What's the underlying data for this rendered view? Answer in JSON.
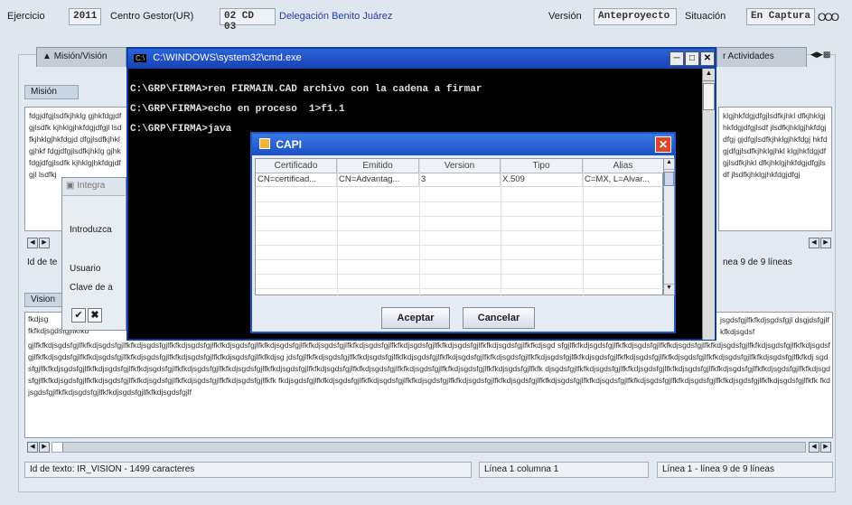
{
  "header": {
    "ejercicio_label": "Ejercicio",
    "ejercicio_value": "2011",
    "centro_label": "Centro Gestor(UR)",
    "centro_value": "02 CD 03",
    "centro_name": "Delegación Benito Juárez",
    "version_label": "Versión",
    "version_value": "Anteproyecto",
    "situacion_label": "Situación",
    "situacion_value": "En Captura",
    "circles": "OOO"
  },
  "tabs": {
    "left": "Misión/Visión",
    "right": "r Actividades"
  },
  "mision": {
    "title": "Misión",
    "text_left": "fdgjdfgjlsdfkjhklg gjhkfdgjdfgjlsdfk kjhklgjhkfdgjdfgjl lsdfkjhklgjhkfdgjd dfgjlsdfkjhklgjhkf fdgjdfgjlsdfkjhklg gjhkfdgjdfgjlsdfk kjhklgjhkfdgjdfgjl lsdfkj",
    "text_right": "klgjhkfdgjdfgjlsdfkjhkl dfkjhklgjhkfdgjdfgjlsdf jlsdfkjhklgjhkfdgjdfgj gjdfgjlsdfkjhklgjhkfdgj hkfdgjdfgjlsdfkjhklgjhkl klgjhkfdgjdfgjlsdfkjhkl dfkjhklgjhkfdgjdfgjlsdf jlsdfkjhklgjhkfdgjdfgj",
    "footer_left": "Id de te",
    "footer_right": "nea 9 de 9 líneas"
  },
  "vision": {
    "title": "Vision",
    "text_top_left": "fkdjsg",
    "text_top_left2": "fkfkdjsgdsfgjlfkfkd",
    "text_top_right": "jsgdsfgjlfkfkdjsgdsfgjl dsgjdsfgjlfkfkdjsgdsf",
    "text_body": "gjlfkfkdjsgdsfgjlfkfkdjsgdsfgjlfkfkdjsgdsfgjlfkfkdjsgdsfgjlfkfkdjsgdsfgjlfkfkdjsgdsfgjlfkfkdjsgdsfgjlfkfkdjsgdsfgjlfkfkdjsgdsfgjlfkfkdjsgdsfgjlfkfkdjsgdsfgjlfkfkdjsgd sfgjlfkfkdjsgdsfgjlfkfkdjsgdsfgjlfkfkdjsgdsfgjlfkfkdjsgdsfgjlfkfkdjsgdsfgjlfkfkdjsgdsfgjlfkfkdjsgdsfgjlfkfkdjsgdsfgjlfkfkdjsgdsfgjlfkfkdjsgdsfgjlfkfkdjsgdsfgjlfkfkdjsg jdsfgjlfkfkdjsgdsfgjlfkfkdjsgdsfgjlfkfkdjsgdsfgjlfkfkdjsgdsfgjlfkfkdjsgdsfgjlfkfkdjsgdsfgjlfkfkdjsgdsfgjlfkfkdjsgdsfgjlfkfkdjsgdsfgjlfkfkdjsgdsfgjlfkfkdjsgdsfgjlfkfkdj sgdsfgjlfkfkdjsgdsfgjlfkfkdjsgdsfgjlfkfkdjsgdsfgjlfkfkdjsgdsfgjlfkfkdjsgdsfgjlfkfkdjsgdsfgjlfkfkdjsgdsfgjlfkfkdjsgdsfgjlfkfkdjsgdsfgjlfkfkdjsgdsfgjlfkfkdjsgdsfgjlfkfk djsgdsfgjlfkfkdjsgdsfgjlfkfkdjsgdsfgjlfkfkdjsgdsfgjlfkfkdjsgdsfgjlfkfkdjsgdsfgjlfkfkdjsgdsfgjlfkfkdjsgdsfgjlfkfkdjsgdsfgjlfkfkdjsgdsfgjlfkfkdjsgdsfgjlfkfkdjsgdsfgjlfkfk fkdjsgdsfgjlfkfkdjsgdsfgjlfkfkdjsgdsfgjlfkfkdjsgdsfgjlfkfkdjsgdsfgjlfkfkdjsgdsfgjlfkfkdjsgdsfgjlfkfkdjsgdsfgjlfkfkdjsgdsfgjlfkfkdjsgdsfgjlfkfkdjsgdsfgjlfkfkdjsgdsfgjlfkfk fkdjsgdsfgjlfkfkdjsgdsfgjlfkfkdjsgdsfgjlfkfkdjsgdsfgjlf"
  },
  "status": {
    "id_text": "Id de texto: IR_VISION - 1499 caracteres",
    "position": "Línea 1 columna 1",
    "lines": "Línea 1 - línea 9 de 9 líneas"
  },
  "login": {
    "title": "Integra",
    "introduzca": "Introduzca",
    "usuario": "Usuario",
    "clave": "Clave de a"
  },
  "cmd": {
    "title": "C:\\WINDOWS\\system32\\cmd.exe",
    "line1": "C:\\GRP\\FIRMA>ren FIRMAIN.CAD archivo con la cadena a firmar",
    "line2": "C:\\GRP\\FIRMA>echo en proceso  1>f1.1",
    "line3": "C:\\GRP\\FIRMA>java"
  },
  "capi": {
    "title": "CAPI",
    "columns": [
      "Certificado",
      "Emitido",
      "Version",
      "Tipo",
      "Alias"
    ],
    "row": [
      "CN=certificad...",
      "CN=Advantag...",
      "3",
      "X.509",
      "C=MX, L=Alvar..."
    ],
    "accept": "Aceptar",
    "cancel": "Cancelar"
  },
  "colors": {
    "titlebar_blue": "#1742b4",
    "link_blue": "#1f3fae",
    "close_red": "#d9482b"
  }
}
